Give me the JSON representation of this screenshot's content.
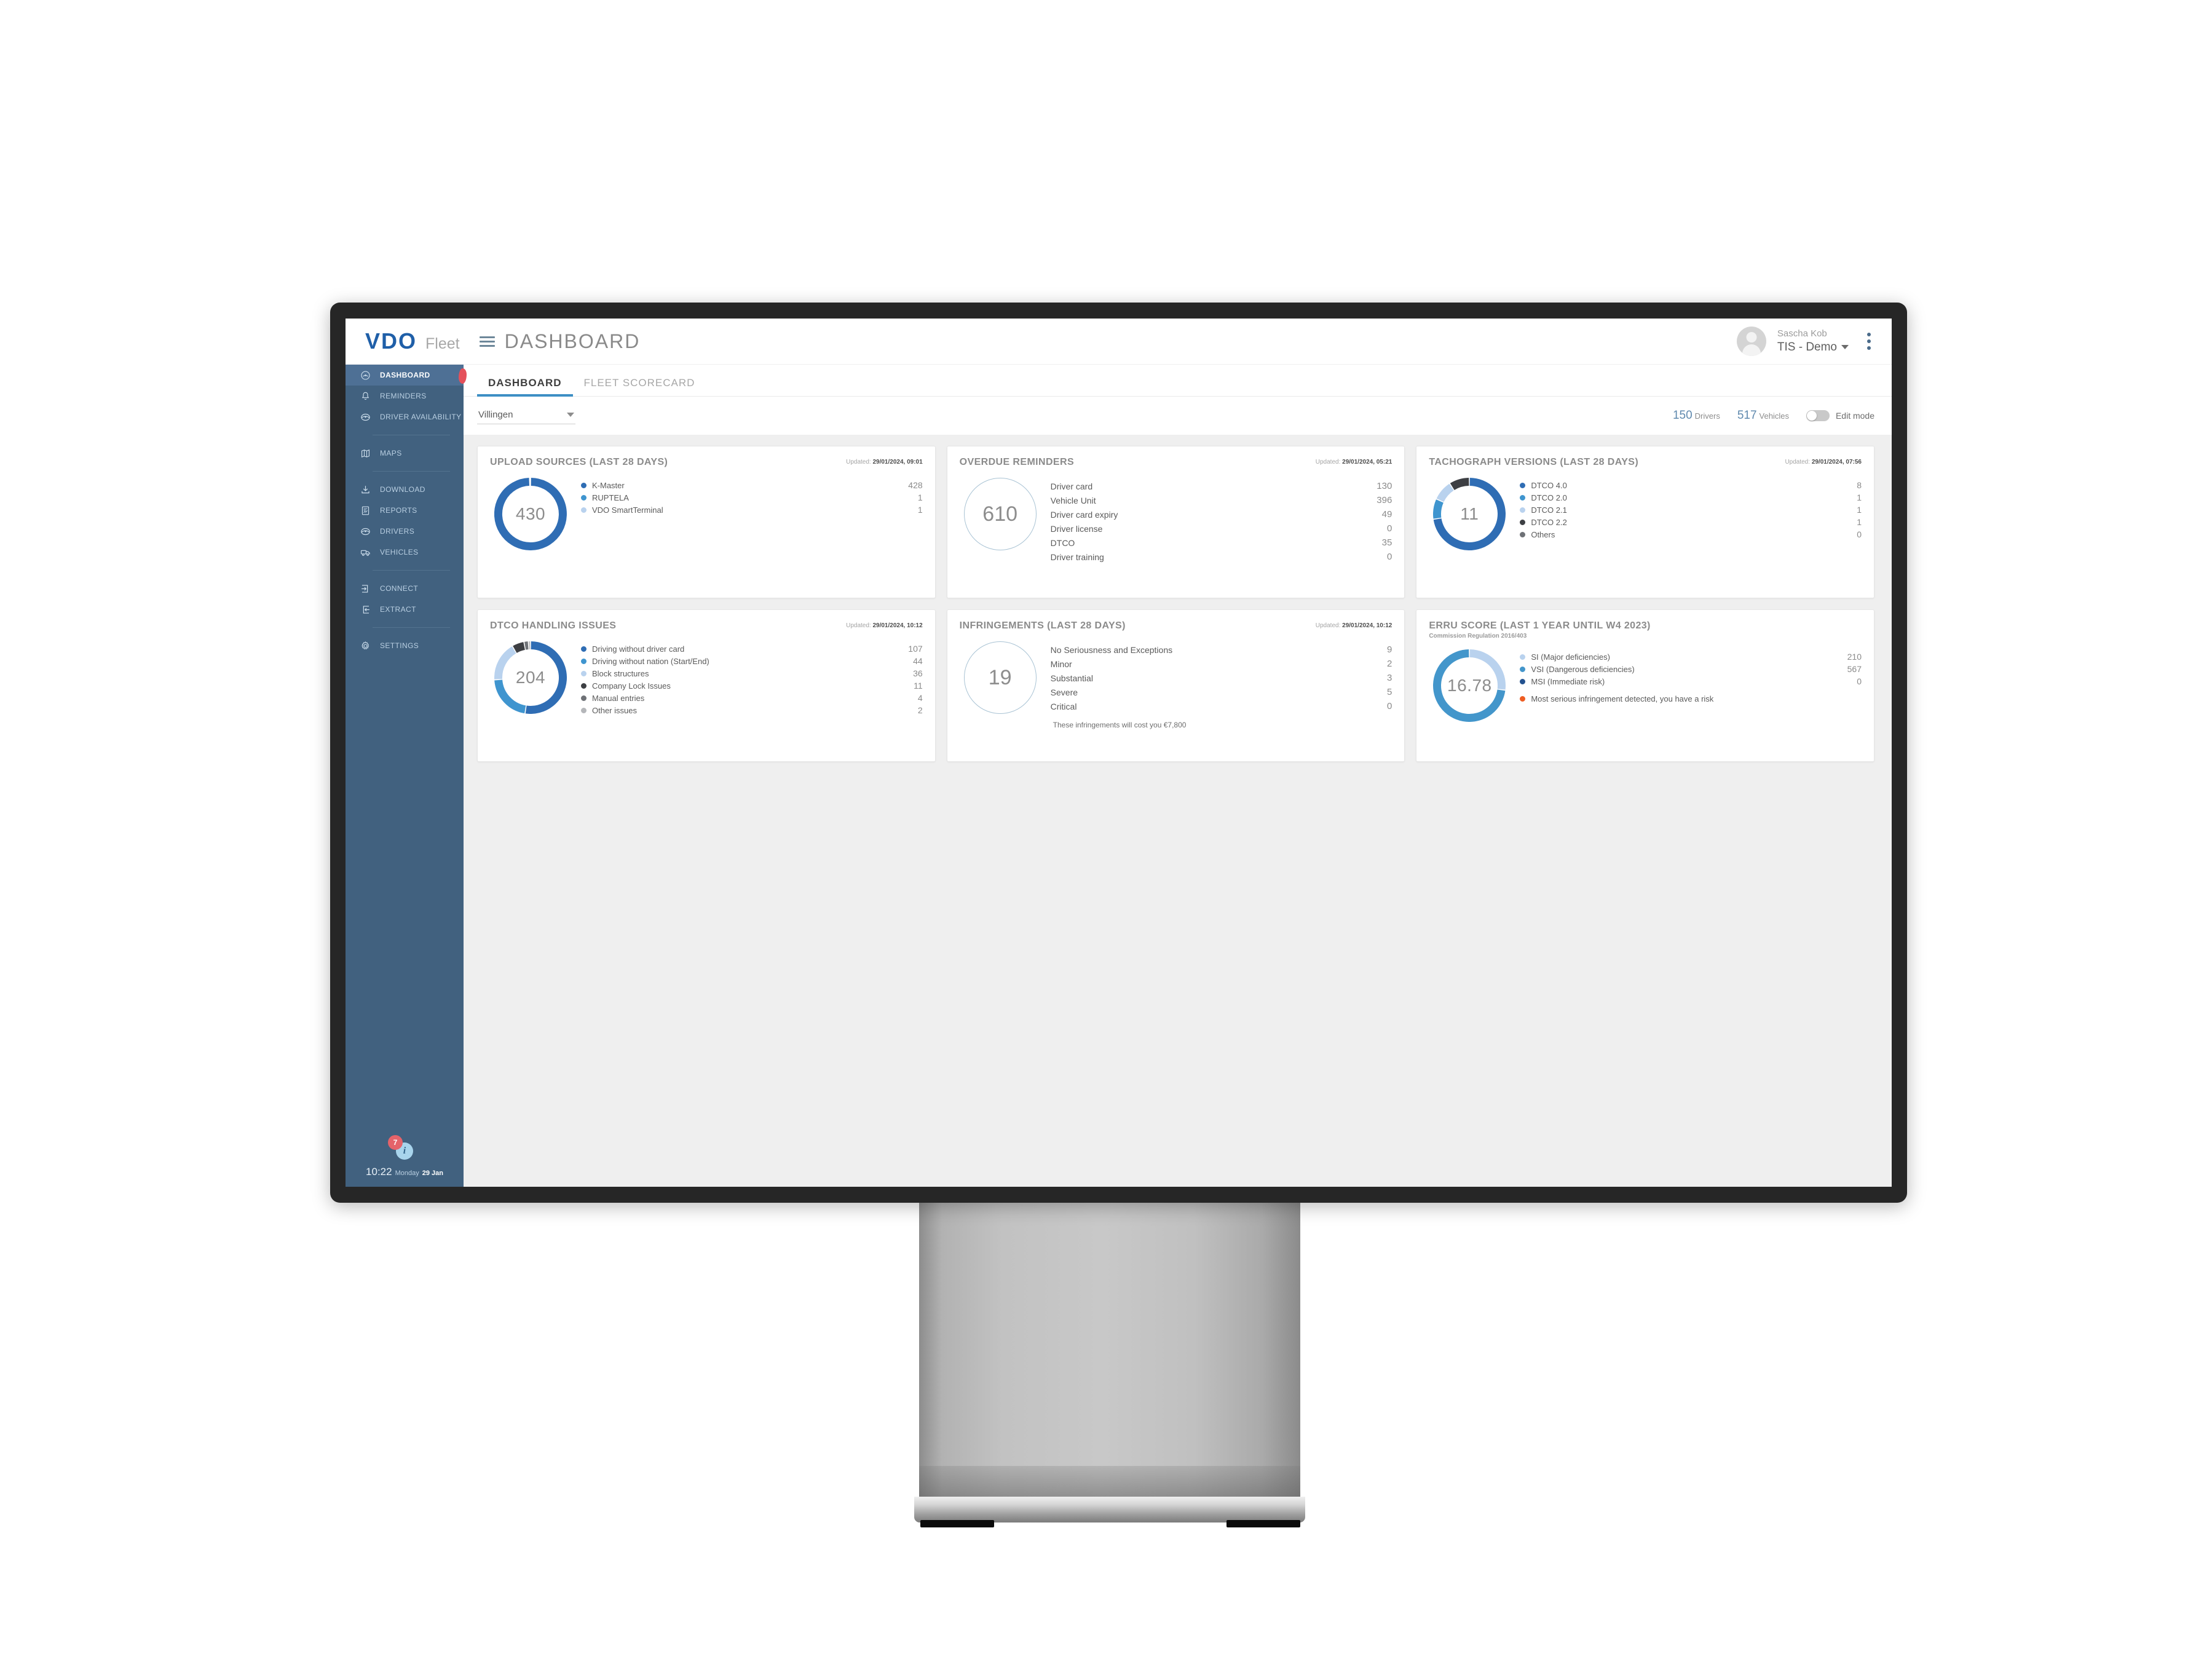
{
  "header": {
    "logo_text": "VDO",
    "logo_suffix": "Fleet",
    "page_title": "DASHBOARD",
    "user_name": "Sascha Kob",
    "user_org": "TIS - Demo"
  },
  "sidebar": {
    "items": [
      {
        "label": "DASHBOARD",
        "icon": "gauge-icon",
        "active": true
      },
      {
        "label": "REMINDERS",
        "icon": "bell-icon",
        "active": false
      },
      {
        "label": "DRIVER AVAILABILITY",
        "icon": "driver-icon",
        "active": false
      },
      {
        "label": "MAPS",
        "icon": "map-icon",
        "active": false
      },
      {
        "label": "DOWNLOAD",
        "icon": "download-icon",
        "active": false
      },
      {
        "label": "REPORTS",
        "icon": "report-icon",
        "active": false
      },
      {
        "label": "DRIVERS",
        "icon": "driver-icon",
        "active": false
      },
      {
        "label": "VEHICLES",
        "icon": "truck-icon",
        "active": false
      },
      {
        "label": "CONNECT",
        "icon": "login-icon",
        "active": false
      },
      {
        "label": "EXTRACT",
        "icon": "logout-icon",
        "active": false
      },
      {
        "label": "SETTINGS",
        "icon": "gear-icon",
        "active": false
      }
    ],
    "notification_badge": "7",
    "info_glyph": "i",
    "clock_time": "10:22",
    "clock_day": "Monday",
    "clock_date": "29 Jan"
  },
  "tabs": [
    {
      "label": "DASHBOARD",
      "active": true
    },
    {
      "label": "FLEET SCORECARD",
      "active": false
    }
  ],
  "filterbar": {
    "location_value": "Villingen",
    "drivers_count": "150",
    "drivers_label": "Drivers",
    "vehicles_count": "517",
    "vehicles_label": "Vehicles",
    "edit_mode_label": "Edit mode",
    "edit_mode_on": false
  },
  "colors": {
    "brand_blue": "#1f5fa8",
    "sidebar": "#41617f",
    "accent_tab": "#3d8fc4",
    "d1": "#2f6db4",
    "d2": "#3f95cf",
    "d3": "#b9d2ee",
    "d4": "#3d3f43",
    "d5": "#6e7176",
    "d6": "#b5b7ba",
    "erru_si": "#b9d2ee",
    "erru_vsi": "#4396cb",
    "erru_msi": "#23528f",
    "erru_warn": "#ee5d22"
  },
  "chart_data": [
    {
      "type": "pie",
      "id": "upload-sources",
      "title": "UPLOAD SOURCES (LAST 28 DAYS)",
      "updated_prefix": "Updated:",
      "updated": "29/01/2024, 09:01",
      "center_value": "430",
      "legend_position": "right",
      "categories": [
        "K-Master",
        "RUPTELA",
        "VDO SmartTerminal"
      ],
      "values": [
        428,
        1,
        1
      ],
      "value_labels": [
        "428",
        "1",
        "1"
      ],
      "colors": [
        "#2f6db4",
        "#3f95cf",
        "#b9d2ee"
      ]
    },
    {
      "type": "table",
      "id": "overdue-reminders",
      "title": "OVERDUE REMINDERS",
      "updated_prefix": "Updated:",
      "updated": "29/01/2024, 05:21",
      "center_value": "610",
      "outline_only": true,
      "categories": [
        "Driver card",
        "Vehicle Unit",
        "Driver card expiry",
        "Driver license",
        "DTCO",
        "Driver training"
      ],
      "values": [
        130,
        396,
        49,
        0,
        35,
        0
      ],
      "value_labels": [
        "130",
        "396",
        "49",
        "0",
        "35",
        "0"
      ]
    },
    {
      "type": "pie",
      "id": "tachograph-versions",
      "title": "TACHOGRAPH VERSIONS (LAST 28 DAYS)",
      "updated_prefix": "Updated:",
      "updated": "29/01/2024, 07:56",
      "center_value": "11",
      "legend_position": "right",
      "categories": [
        "DTCO 4.0",
        "DTCO 2.0",
        "DTCO 2.1",
        "DTCO 2.2",
        "Others"
      ],
      "values": [
        8,
        1,
        1,
        1,
        0
      ],
      "value_labels": [
        "8",
        "1",
        "1",
        "1",
        "0"
      ],
      "colors": [
        "#2f6db4",
        "#3f95cf",
        "#b9d2ee",
        "#3d3f43",
        "#6e7176"
      ]
    },
    {
      "type": "pie",
      "id": "dtco-handling-issues",
      "title": "DTCO HANDLING ISSUES",
      "updated_prefix": "Updated:",
      "updated": "29/01/2024, 10:12",
      "center_value": "204",
      "legend_position": "right",
      "categories": [
        "Driving without driver card",
        "Driving without nation (Start/End)",
        "Block structures",
        "Company Lock Issues",
        "Manual entries",
        "Other issues"
      ],
      "values": [
        107,
        44,
        36,
        11,
        4,
        2
      ],
      "value_labels": [
        "107",
        "44",
        "36",
        "11",
        "4",
        "2"
      ],
      "colors": [
        "#2f6db4",
        "#3f95cf",
        "#b9d2ee",
        "#3d3f43",
        "#6e7176",
        "#b5b7ba"
      ]
    },
    {
      "type": "table",
      "id": "infringements",
      "title": "INFRINGEMENTS (LAST 28 DAYS)",
      "updated_prefix": "Updated:",
      "updated": "29/01/2024, 10:12",
      "center_value": "19",
      "outline_only": true,
      "categories": [
        "No Seriousness and Exceptions",
        "Minor",
        "Substantial",
        "Severe",
        "Critical"
      ],
      "values": [
        9,
        2,
        3,
        5,
        0
      ],
      "value_labels": [
        "9",
        "2",
        "3",
        "5",
        "0"
      ],
      "note": "These infringements will cost you €7,800"
    },
    {
      "type": "pie",
      "id": "erru-score",
      "title": "ERRU SCORE (LAST 1 YEAR UNTIL W4 2023)",
      "subtitle": "Commission Regulation 2016/403",
      "center_value": "16.78",
      "legend_position": "right",
      "categories": [
        "SI (Major deficiencies)",
        "VSI (Dangerous deficiencies)",
        "MSI (Immediate risk)"
      ],
      "values": [
        210,
        567,
        0
      ],
      "value_labels": [
        "210",
        "567",
        "0"
      ],
      "colors": [
        "#b9d2ee",
        "#4396cb",
        "#23528f"
      ],
      "warning_text": "Most serious infringement detected, you have a risk",
      "warning_color": "#ee5d22"
    }
  ]
}
